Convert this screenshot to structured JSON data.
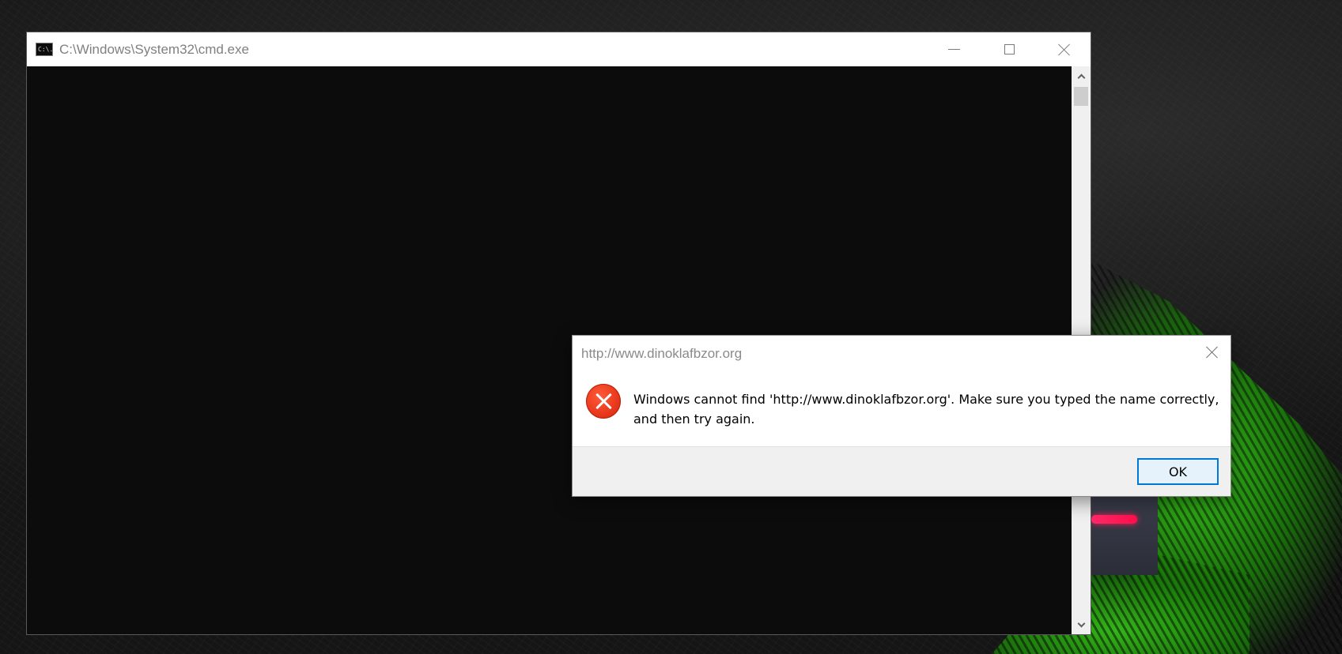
{
  "cmd_window": {
    "title": "C:\\Windows\\System32\\cmd.exe",
    "icon": "cmd-icon",
    "icon_glyph": "C:\\.",
    "controls": {
      "minimize_icon": "minimize-icon",
      "maximize_icon": "maximize-icon",
      "close_icon": "close-icon"
    },
    "console_background": "#0c0c0c"
  },
  "error_dialog": {
    "title": "http://www.dinoklafbzor.org",
    "icon": "error-icon",
    "message": "Windows cannot find 'http://www.dinoklafbzor.org'. Make sure you typed the name correctly, and then try again.",
    "ok_label": "OK",
    "accent_color": "#0078d7",
    "error_color": "#e8381c"
  }
}
